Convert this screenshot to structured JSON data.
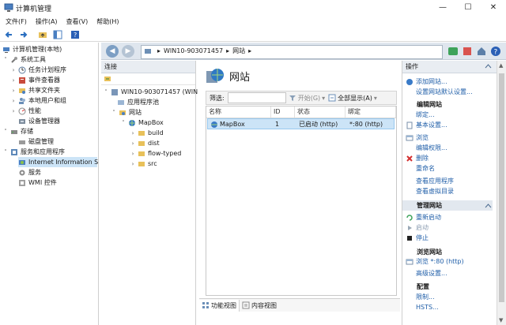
{
  "window": {
    "title": "计算机管理",
    "controls": [
      "—",
      "☐",
      "✕"
    ]
  },
  "menu": {
    "items": [
      "文件(F)",
      "操作(A)",
      "查看(V)",
      "帮助(H)"
    ]
  },
  "tree": {
    "root": "计算机管理(本地)",
    "system_tools": "系统工具",
    "task_scheduler": "任务计划程序",
    "event_viewer": "事件查看器",
    "shared_folders": "共享文件夹",
    "local_users": "本地用户和组",
    "performance": "性能",
    "device_manager": "设备管理器",
    "storage": "存储",
    "disk_mgmt": "磁盘管理",
    "services_apps": "服务和应用程序",
    "iis": "Internet Information S",
    "services": "服务",
    "wmi": "WMI 控件"
  },
  "iis": {
    "address": {
      "server": "WIN10-903071457",
      "node": "网站"
    },
    "connections": {
      "header": "连接",
      "server": "WIN10-903071457 (WIN",
      "app_pools": "应用程序池",
      "sites": "网站",
      "mapbox": "MapBox",
      "folders": [
        "build",
        "dist",
        "flow-typed",
        "src"
      ]
    },
    "center": {
      "title": "网站",
      "filter_label": "筛选:",
      "start_label": "开始(G)",
      "show_all_label": "全部显示(A)",
      "columns": [
        "名称",
        "ID",
        "状态",
        "绑定"
      ],
      "rows": [
        {
          "name": "MapBox",
          "id": "1",
          "status": "已启动 (http)",
          "binding": "*:80 (http)"
        }
      ],
      "tab_features": "功能视图",
      "tab_content": "内容视图"
    },
    "actions": {
      "header": "操作",
      "add_site": "添加网站...",
      "set_defaults": "设置网站默认设置...",
      "edit_site_header": "编辑网站",
      "bindings": "绑定...",
      "basic_settings": "基本设置...",
      "browse": "浏览",
      "edit_perms": "编辑权限...",
      "delete": "删除",
      "rename": "重命名",
      "view_apps": "查看应用程序",
      "view_vdirs": "查看虚拟目录",
      "manage_site_header": "管理网站",
      "restart": "重新启动",
      "start": "启动",
      "stop": "停止",
      "browse_site_header": "浏览网站",
      "browse_80": "浏览 *:80 (http)",
      "advanced": "高级设置...",
      "config_header": "配置",
      "limits": "限制...",
      "hsts": "HSTS..."
    }
  },
  "colors": {
    "accent_blue": "#1f5ea8",
    "selection": "#cce4f7",
    "folder": "#e8c15a"
  }
}
